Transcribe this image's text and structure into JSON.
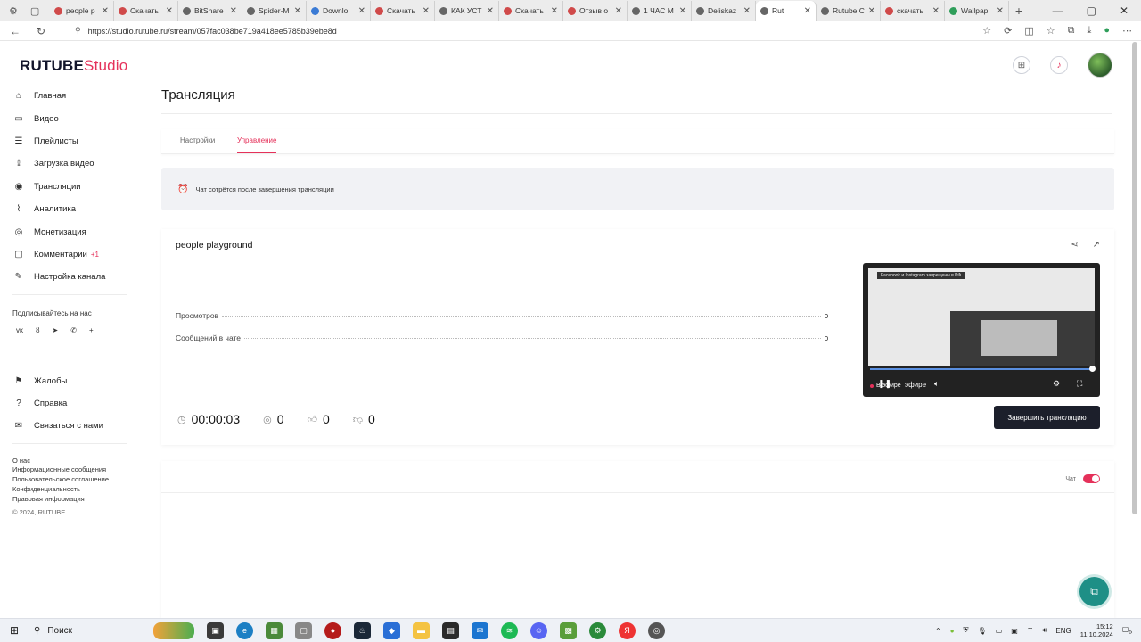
{
  "browser": {
    "tabs": [
      {
        "title": "people p",
        "color": "#d04a4a"
      },
      {
        "title": "Скачать",
        "color": "#d04a4a"
      },
      {
        "title": "BitShare",
        "color": "#666"
      },
      {
        "title": "Spider-M",
        "color": "#666"
      },
      {
        "title": "Downlo",
        "color": "#3b7bd5"
      },
      {
        "title": "Скачать",
        "color": "#d04a4a"
      },
      {
        "title": "КАК УСТ",
        "color": "#666"
      },
      {
        "title": "Скачать",
        "color": "#d04a4a"
      },
      {
        "title": "Отзыв о",
        "color": "#d04a4a"
      },
      {
        "title": "1 ЧАС М",
        "color": "#666"
      },
      {
        "title": "Deliskaz",
        "color": "#666"
      },
      {
        "title": "Rut",
        "color": "#666",
        "active": true
      },
      {
        "title": "Rutube С",
        "color": "#666"
      },
      {
        "title": "скачать",
        "color": "#d04a4a"
      },
      {
        "title": "Wallpap",
        "color": "#2f9e5a"
      }
    ],
    "url": "https://studio.rutube.ru/stream/057fac038be719a418ee5785b39ebe8d"
  },
  "brand": {
    "name": "RUTUBE",
    "suffix": "Studio"
  },
  "sidebar": {
    "items": [
      {
        "label": "Главная",
        "icon": "home-icon",
        "glyph": "⌂"
      },
      {
        "label": "Видео",
        "icon": "video-icon",
        "glyph": "▭"
      },
      {
        "label": "Плейлисты",
        "icon": "playlist-icon",
        "glyph": "☰"
      },
      {
        "label": "Загрузка видео",
        "icon": "upload-icon",
        "glyph": "⇪"
      },
      {
        "label": "Трансляции",
        "icon": "broadcast-icon",
        "glyph": "◉"
      },
      {
        "label": "Аналитика",
        "icon": "analytics-icon",
        "glyph": "⌇"
      },
      {
        "label": "Монетизация",
        "icon": "money-icon",
        "glyph": "◎"
      },
      {
        "label": "Комментарии",
        "icon": "comments-icon",
        "glyph": "▢",
        "count": "+1"
      },
      {
        "label": "Настройка канала",
        "icon": "channel-settings-icon",
        "glyph": "✎"
      }
    ],
    "subscribe_label": "Подписывайтесь на нас",
    "socials": [
      "vk",
      "ok",
      "telegram",
      "viber",
      "+"
    ],
    "help_items": [
      {
        "label": "Жалобы",
        "icon": "flag-icon",
        "glyph": "⚑"
      },
      {
        "label": "Справка",
        "icon": "help-icon",
        "glyph": "?"
      },
      {
        "label": "Связаться с нами",
        "icon": "contact-icon",
        "glyph": "✉"
      }
    ],
    "footer_links": [
      "О нас",
      "Информационные сообщения",
      "Пользовательское соглашение",
      "Конфиденциальность",
      "Правовая информация"
    ],
    "copyright": "© 2024, RUTUBE"
  },
  "main": {
    "title": "Трансляция",
    "tabs": [
      "Настройки",
      "Управление"
    ],
    "notice": "Чат сотрётся после завершения трансляции",
    "stream": {
      "name": "people playground",
      "stats": [
        {
          "label": "Просмотров",
          "value": "0"
        },
        {
          "label": "Сообщений в чате",
          "value": "0"
        }
      ],
      "duration": "00:00:03",
      "viewers": "0",
      "likes": "0",
      "dislikes": "0",
      "preview_banner": "Facebook и Instagram запрещены в РФ",
      "live_label": "В эфире",
      "live_overlay": "эфире",
      "end_button": "Завершить трансляцию"
    },
    "chat_label": "Чат"
  },
  "taskbar": {
    "search": "Поиск",
    "lang": "ENG",
    "time": "15:12",
    "date": "11.10.2024",
    "notif": "5"
  }
}
